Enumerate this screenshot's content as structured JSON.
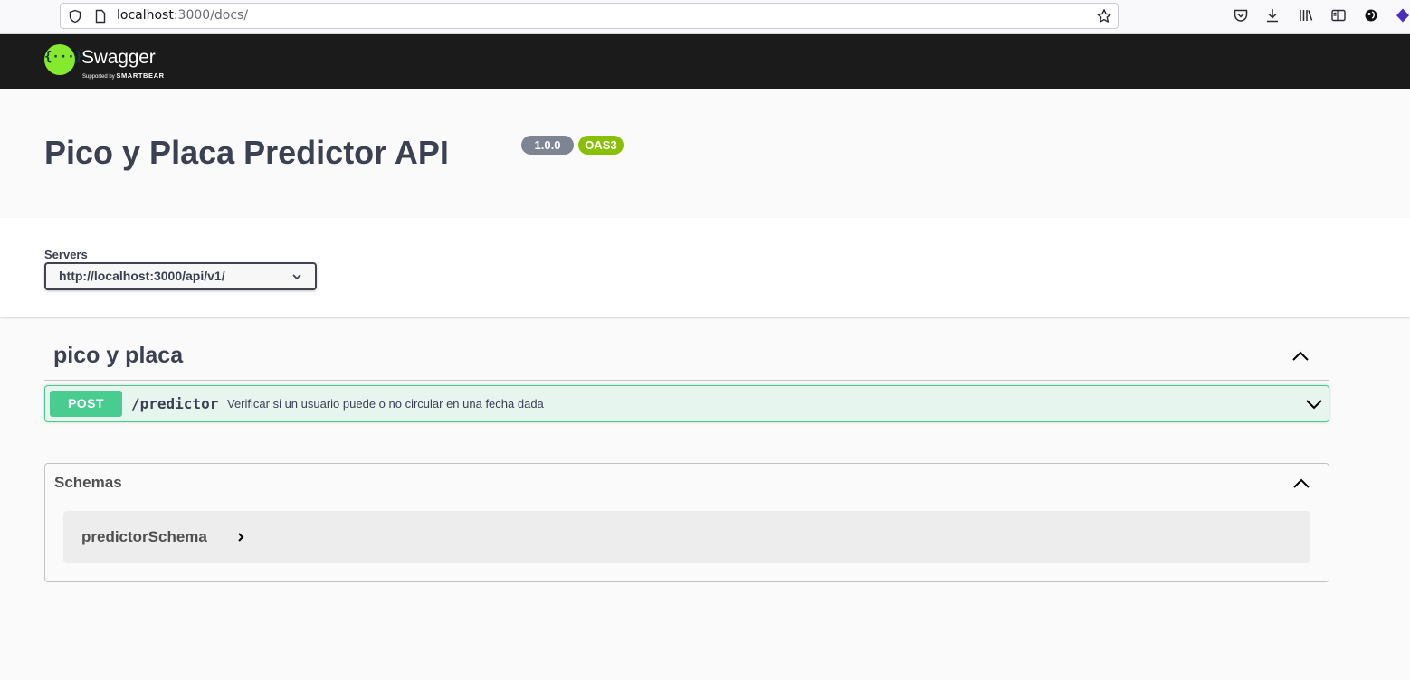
{
  "browser": {
    "url_host": "localhost",
    "url_rest": ":3000/docs/",
    "icons": [
      "shield-icon",
      "page-icon",
      "bookmark-star-icon",
      "pocket-icon",
      "downloads-icon",
      "library-icon",
      "sidebar-icon",
      "extension-icon",
      "extension-purple-icon"
    ]
  },
  "topbar": {
    "logo_mark": "{···}",
    "logo_word": "Swagger",
    "logo_sub_prefix": "Supported by ",
    "logo_sub_brand": "SMARTBEAR"
  },
  "info": {
    "title": "Pico y Placa Predictor API",
    "version": "1.0.0",
    "oas": "OAS3"
  },
  "servers": {
    "label": "Servers",
    "selected": "http://localhost:3000/api/v1/"
  },
  "tag": {
    "name": "pico y placa",
    "operations": [
      {
        "method": "POST",
        "path": "/predictor",
        "summary": "Verificar si un usuario puede o no circular en una fecha dada"
      }
    ]
  },
  "schemas": {
    "title": "Schemas",
    "items": [
      "predictorSchema"
    ]
  },
  "colors": {
    "topbar_bg": "#1b1b1b",
    "logo_green": "#85ea2d",
    "post_green": "#49cc90",
    "version_badge": "#7d8492",
    "oas_badge": "#89bf04",
    "text": "#3b4151"
  }
}
